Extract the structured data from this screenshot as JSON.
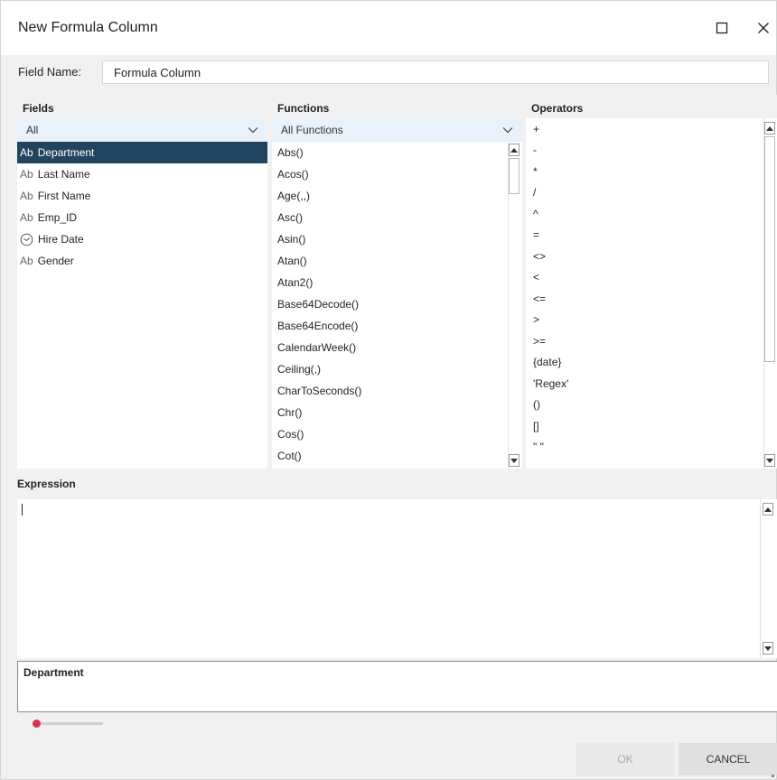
{
  "window": {
    "title": "New Formula Column"
  },
  "field_name": {
    "label": "Field Name:",
    "value": "Formula Column"
  },
  "fields_panel": {
    "header": "Fields",
    "filter_value": "All",
    "items": [
      {
        "icon_text": "Ab",
        "icon": "text-type-icon",
        "label": "Department",
        "selected": true
      },
      {
        "icon_text": "Ab",
        "icon": "text-type-icon",
        "label": "Last Name",
        "selected": false
      },
      {
        "icon_text": "Ab",
        "icon": "text-type-icon",
        "label": "First Name",
        "selected": false
      },
      {
        "icon_text": "Ab",
        "icon": "text-type-icon",
        "label": "Emp_ID",
        "selected": false
      },
      {
        "icon_text": "",
        "icon": "clock-icon",
        "label": "Hire Date",
        "selected": false
      },
      {
        "icon_text": "Ab",
        "icon": "text-type-icon",
        "label": "Gender",
        "selected": false
      }
    ]
  },
  "functions_panel": {
    "header": "Functions",
    "filter_value": "All Functions",
    "items": [
      "Abs()",
      "Acos()",
      "Age(,,)",
      "Asc()",
      "Asin()",
      "Atan()",
      "Atan2()",
      "Base64Decode()",
      "Base64Encode()",
      "CalendarWeek()",
      "Ceiling(,)",
      "CharToSeconds()",
      "Chr()",
      "Cos()",
      "Cot()"
    ]
  },
  "operators_panel": {
    "header": "Operators",
    "items": [
      "+",
      "-",
      "*",
      "/",
      "^",
      "=",
      "<>",
      "<",
      "<=",
      ">",
      ">=",
      "{date}",
      "'Regex'",
      "()",
      "[]",
      "\" \""
    ]
  },
  "expression": {
    "header": "Expression",
    "value": ""
  },
  "description": {
    "text": "Department"
  },
  "zoom_slider": {
    "level": 0.0,
    "color": "#e0304e"
  },
  "buttons": {
    "ok": "OK",
    "cancel": "CANCEL"
  },
  "colors": {
    "selected_row": "#22455f",
    "dropdown_bg": "#e9f1fb",
    "dialog_bg": "#f1f1f1"
  }
}
